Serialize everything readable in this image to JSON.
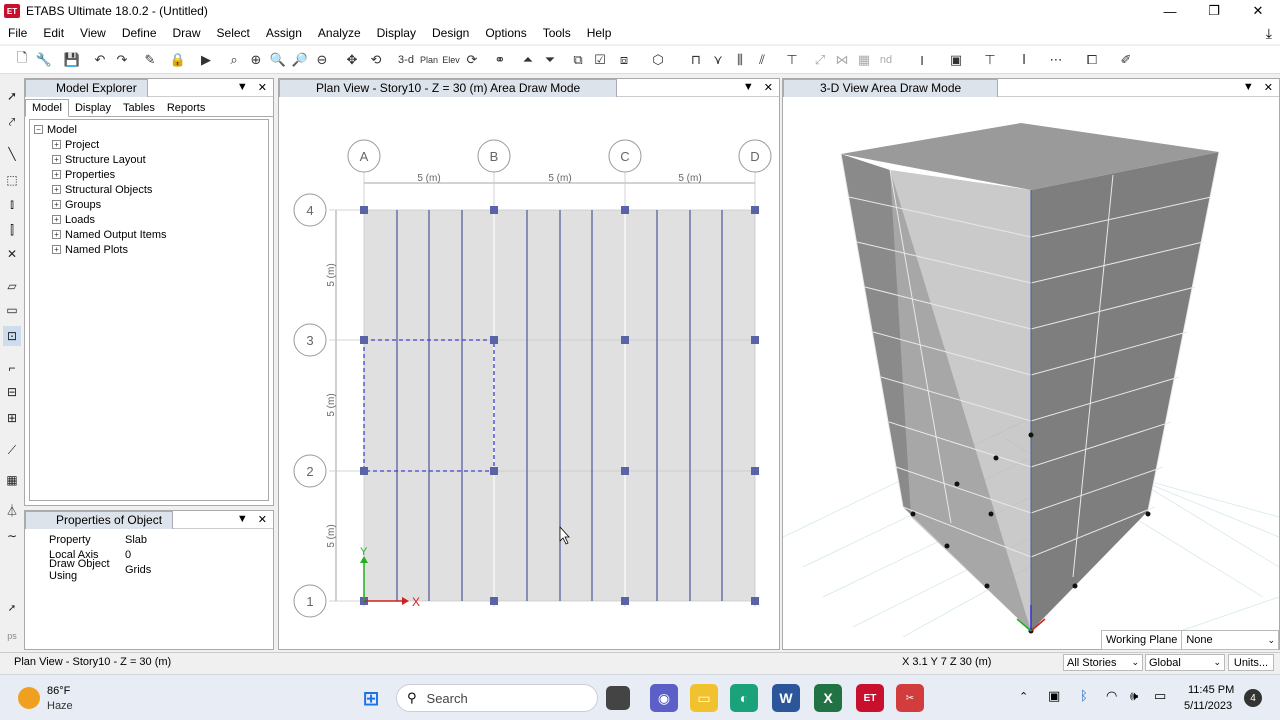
{
  "app": {
    "icon_label": "ET",
    "title": "ETABS Ultimate 18.0.2 - (Untitled)"
  },
  "window_controls": {
    "minimize": "—",
    "maximize": "❐",
    "close": "✕"
  },
  "menu": [
    "File",
    "Edit",
    "View",
    "Define",
    "Draw",
    "Select",
    "Assign",
    "Analyze",
    "Display",
    "Design",
    "Options",
    "Tools",
    "Help"
  ],
  "toolbar": {
    "view_3d_label": "3-d",
    "plan_label": "Plan",
    "elev_label": "Elev",
    "nd_label": "nd"
  },
  "model_explorer": {
    "title": "Model Explorer",
    "tabs": [
      "Model",
      "Display",
      "Tables",
      "Reports"
    ],
    "tree_root": "Model",
    "tree_items": [
      "Project",
      "Structure Layout",
      "Properties",
      "Structural Objects",
      "Groups",
      "Loads",
      "Named Output Items",
      "Named Plots"
    ]
  },
  "properties_panel": {
    "title": "Properties of Object",
    "rows": [
      {
        "key": "Property",
        "value": "Slab"
      },
      {
        "key": "Local Axis",
        "value": "0"
      },
      {
        "key": "Draw Object Using",
        "value": "Grids"
      }
    ]
  },
  "plan_view": {
    "title": "Plan View - Story10 - Z = 30 (m)  Area Draw Mode",
    "grid_x_labels": [
      "A",
      "B",
      "C",
      "D"
    ],
    "grid_y_labels": [
      "4",
      "3",
      "2",
      "1"
    ],
    "x_spacing_label": "5 (m)",
    "y_spacing_label": "5 (m)",
    "axis_x": "X",
    "axis_y": "Y"
  },
  "view_3d": {
    "title": "3-D View  Area Draw Mode",
    "working_plane_label": "Working Plane",
    "working_plane_value": "None"
  },
  "status": {
    "left": "Plan View - Story10 - Z = 30 (m)",
    "coords": "X 3.1  Y 7  Z 30 (m)",
    "stories_select": "All Stories",
    "coord_system_select": "Global",
    "units_button": "Units..."
  },
  "taskbar": {
    "weather_temp": "86°F",
    "weather_desc": "Haze",
    "search_placeholder": "Search",
    "time": "11:45 PM",
    "date": "5/11/2023",
    "notification_count": "4"
  },
  "colors": {
    "slab_fill": "#e0e0e0",
    "beam_line": "#2c3d8f",
    "grid_point": "#5a63a6",
    "selection_dash": "#4040d0",
    "panel_tab": "#dde3ea",
    "building_gray": "#8a8a8a"
  }
}
